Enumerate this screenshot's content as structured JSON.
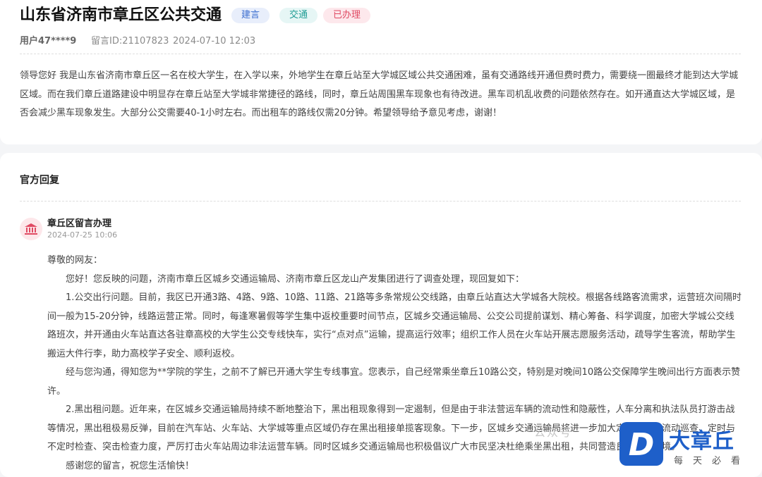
{
  "post": {
    "title": "山东省济南市章丘区公共交通",
    "tags": {
      "type": "建言",
      "category": "交通",
      "status": "已办理"
    },
    "user": "用户47****9",
    "message_id": "留言ID:21107823",
    "datetime": "2024-07-10 12:03",
    "content": "领导您好 我是山东省济南市章丘区一名在校大学生，在入学以来，外地学生在章丘站至大学城区域公共交通困难，虽有交通路线开通但费时费力，需要绕一圈最终才能到达大学城区域。而在我们章丘道路建设中明显存在章丘站至大学城非常捷径的路线，同时，章丘站周围黑车现象也有待改进。黑车司机乱收费的问题依然存在。如开通直达大学城区域，是否会减少黑车现象发生。大部分公交需要40-1小时左右。而出租车的路线仅需20分钟。希望领导给予意见考虑，谢谢！"
  },
  "reply": {
    "section_title": "官方回复",
    "replier": "章丘区留言办理",
    "datetime": "2024-07-25 10:06",
    "salutation": "尊敬的网友：",
    "paragraphs": [
      "您好！您反映的问题，济南市章丘区城乡交通运输局、济南市章丘区龙山产发集团进行了调查处理，现回复如下：",
      "1.公交出行问题。目前，我区已开通3路、4路、9路、10路、11路、21路等多条常规公交线路，由章丘站直达大学城各大院校。根据各线路客流需求，运营班次间隔时间一般为15-20分钟，线路运营正常。同时，每逢寒暑假等学生集中返校重要时间节点，区城乡交通运输局、公交公司提前谋划、精心筹备、科学调度，加密大学城公交线路班次，并开通由火车站直达各驻章高校的大学生公交专线快车，实行“点对点”运输，提高运行效率；组织工作人员在火车站开展志愿服务活动，疏导学生客流，帮助学生搬运大件行李，助力高校学子安全、顺利返校。",
      "经与您沟通，得知您为**学院的学生，之前不了解已开通大学生专线事宜。您表示，自己经常乘坐章丘10路公交，特别是对晚间10路公交保障学生晚间出行方面表示赞许。",
      "2.黑出租问题。近年来，在区城乡交通运输局持续不断地整治下，黑出租现象得到一定遏制，但是由于非法营运车辆的流动性和隐蔽性，人车分离和执法队员打游击战等情况，黑出租极易反弹，目前在汽车站、火车站、大学城等重点区域仍存在黑出租接单揽客现象。下一步，区城乡交通运输局将进一步加大定点检查与流动巡查、定时与不定时检查、突击检查力度，严厉打击火车站周边非法运营车辆。同时区城乡交通运输局也积极倡议广大市民坚决杜绝乘坐黑出租，共同营造良好出行环境。",
      "感谢您的留言，祝您生活愉快！"
    ]
  },
  "watermark": {
    "wechat_text": "公众号",
    "logo_letter": "D",
    "logo_name": "大章丘",
    "slogan": "每天必看"
  },
  "icons": {
    "avatar": "government-building-icon",
    "logo": "da-zhangqiu-logo-icon"
  },
  "colors": {
    "accent_blue": "#1e5fc9",
    "tag_blue": "#3d6fd0",
    "tag_teal": "#1f9c94",
    "tag_red": "#e04a63"
  }
}
